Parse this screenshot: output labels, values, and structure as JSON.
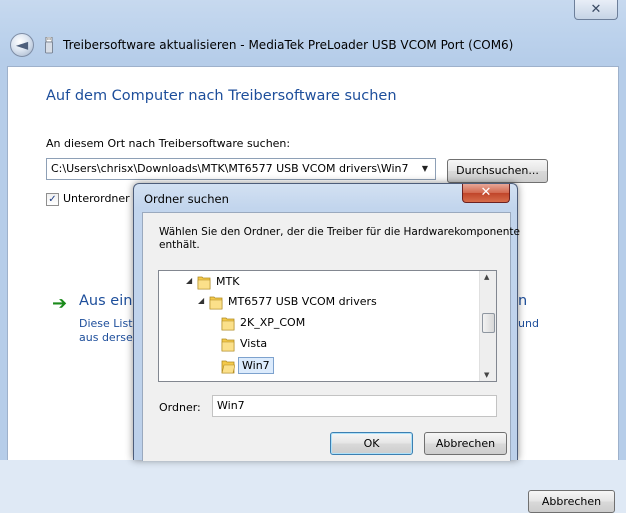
{
  "main_window": {
    "close_glyph": "✕",
    "back_glyph": "◄",
    "title": "Treibersoftware aktualisieren - MediaTek PreLoader USB VCOM Port (COM6)",
    "heading": "Auf dem Computer nach Treibersoftware suchen",
    "path_label": "An diesem Ort nach Treibersoftware suchen:",
    "path_value": "C:\\Users\\chrisx\\Downloads\\MTK\\MT6577 USB VCOM drivers\\Win7",
    "combo_arrow": "▼",
    "browse_label": "Durchsuchen...",
    "subfolder_checked": true,
    "subfolder_check_glyph": "✓",
    "subfolder_label": "Unterordner e",
    "option_arrow": "➔",
    "option_title": "Aus eine",
    "option_title_tail": "n",
    "option_desc_line1": "Diese Liste",
    "option_desc_line2": "aus derselb",
    "option_desc_tail": "und",
    "cancel_label": "Abbrechen"
  },
  "dialog": {
    "title": "Ordner suchen",
    "close_glyph": "✕",
    "description_line1": "Wählen Sie den Ordner, der die Treiber für die Hardwarekomponente",
    "description_line2": "enthält.",
    "tree": [
      {
        "label": "MTK",
        "expanded": true,
        "selected": false
      },
      {
        "label": "MT6577 USB VCOM drivers",
        "expanded": true,
        "selected": false
      },
      {
        "label": "2K_XP_COM",
        "expanded": false,
        "selected": false
      },
      {
        "label": "Vista",
        "expanded": false,
        "selected": false
      },
      {
        "label": "Win7",
        "expanded": false,
        "selected": true
      }
    ],
    "expanded_glyph": "◢",
    "scroll_up_glyph": "▲",
    "scroll_down_glyph": "▼",
    "folder_label": "Ordner:",
    "folder_value": "Win7",
    "ok_label": "OK",
    "cancel_label": "Abbrechen"
  },
  "colors": {
    "heading_blue": "#1d4e9b",
    "folder_yellow": "#f4c94a",
    "selection_bg": "#dcebfc"
  }
}
